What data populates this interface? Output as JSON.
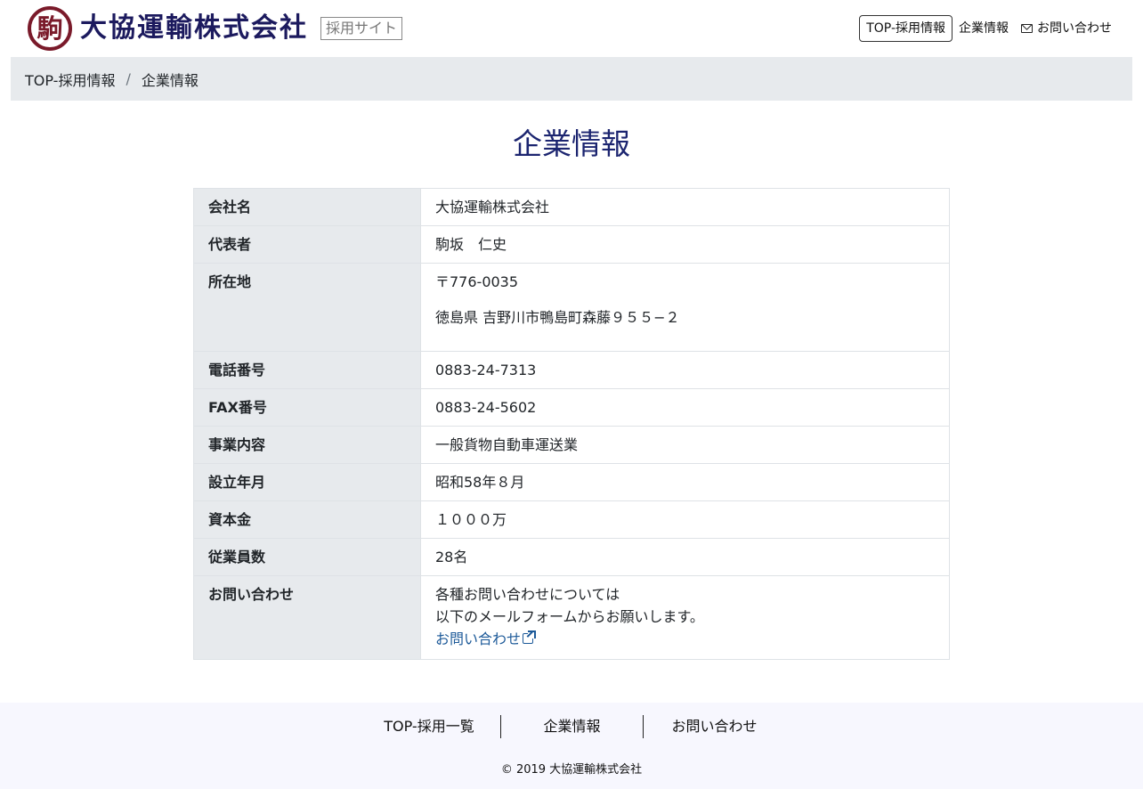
{
  "header": {
    "logo_mark": "駒",
    "company_name": "大協運輸株式会社",
    "site_label": "採用サイト"
  },
  "nav": {
    "items": [
      {
        "label": "TOP-採用情報",
        "active": true
      },
      {
        "label": "企業情報",
        "active": false
      },
      {
        "label": "お問い合わせ",
        "icon": "envelope-icon",
        "active": false
      }
    ]
  },
  "breadcrumb": {
    "items": [
      "TOP-採用情報",
      "企業情報"
    ],
    "separator": "/"
  },
  "main": {
    "title": "企業情報",
    "rows": [
      {
        "label": "会社名",
        "value": "大協運輸株式会社"
      },
      {
        "label": "代表者",
        "value": "駒坂　仁史"
      },
      {
        "label": "所在地",
        "zip": "〒776-0035",
        "address": "徳島県 吉野川市鴨島町森藤９５５−２"
      },
      {
        "label": "電話番号",
        "value": "0883-24-7313"
      },
      {
        "label": "FAX番号",
        "value": "0883-24-5602"
      },
      {
        "label": "事業内容",
        "value": "一般貨物自動車運送業"
      },
      {
        "label": "設立年月",
        "value": "昭和58年８月"
      },
      {
        "label": "資本金",
        "value": "１０００万"
      },
      {
        "label": "従業員数",
        "value": "28名"
      },
      {
        "label": "お問い合わせ",
        "line1": "各種お問い合わせについては",
        "line2": "以下のメールフォームからお願いします。",
        "link": "お問い合わせ",
        "link_icon": "external-link-icon"
      }
    ]
  },
  "footer": {
    "links": [
      "TOP-採用一覧",
      "企業情報",
      "お問い合わせ"
    ],
    "copyright": "© 2019 大協運輸株式会社"
  },
  "colors": {
    "title": "#1c2570",
    "logo_text": "#1c1a5e",
    "logo_mark": "#7a1a2a",
    "link": "#1d5a99",
    "breadcrumb_bg": "#e7eaed",
    "footer_bg": "#f7f7fe"
  }
}
